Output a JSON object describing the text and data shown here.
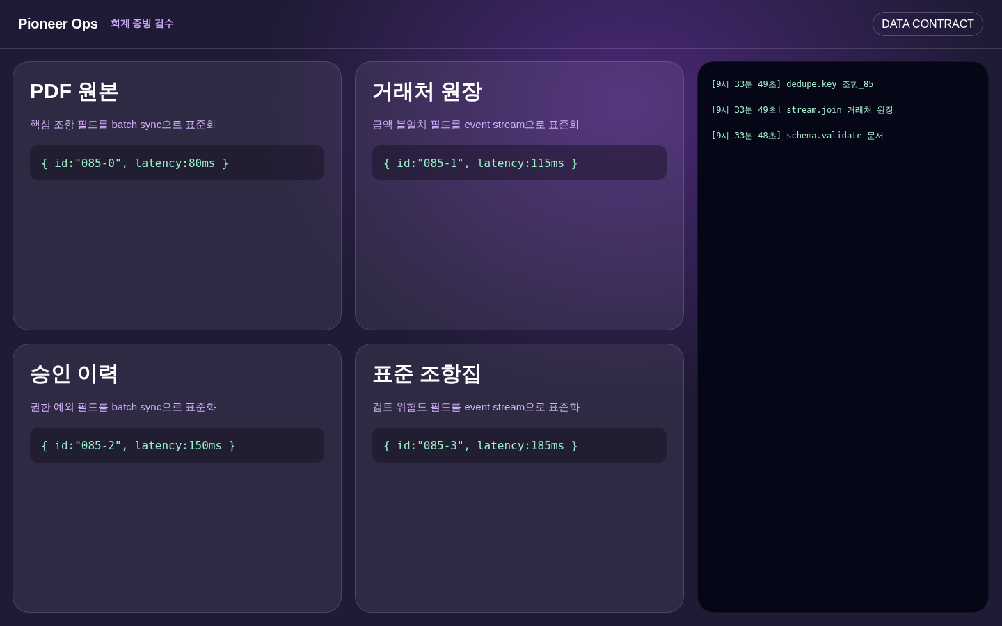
{
  "header": {
    "brand": "Pioneer Ops",
    "subtitle": "회계 증빙 검수",
    "action_button": "DATA CONTRACT"
  },
  "cards": [
    {
      "title": "PDF 원본",
      "description": "핵심 조항 필드를 batch sync으로 표준화",
      "code": "{ id:\"085-0\", latency:80ms }"
    },
    {
      "title": "거래처 원장",
      "description": "금액 불일치 필드를 event stream으로 표준화",
      "code": "{ id:\"085-1\", latency:115ms }"
    },
    {
      "title": "승인 이력",
      "description": "권한 예외 필드를 batch sync으로 표준화",
      "code": "{ id:\"085-2\", latency:150ms }"
    },
    {
      "title": "표준 조항집",
      "description": "검토 위험도 필드를 event stream으로 표준화",
      "code": "{ id:\"085-3\", latency:185ms }"
    }
  ],
  "log": {
    "lines": [
      "[9시 33분 49초] dedupe.key 조항_85",
      "[9시 33분 49초] stream.join 거래처 원장",
      "[9시 33분 48초] schema.validate 문서"
    ]
  }
}
